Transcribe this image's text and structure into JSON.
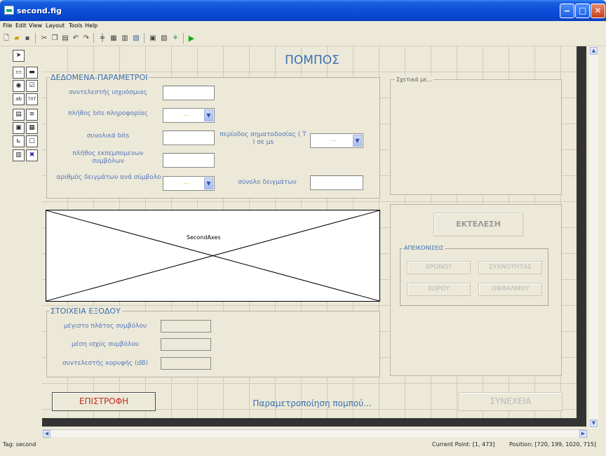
{
  "window": {
    "title": "second.fig"
  },
  "menu": [
    "File",
    "Edit",
    "View",
    "Layout",
    "Tools",
    "Help"
  ],
  "toolbar_icons": [
    "new-icon",
    "open-icon",
    "save-icon",
    "cut-icon",
    "copy-icon",
    "paste-icon",
    "undo-icon",
    "redo-icon",
    "align-icon",
    "menu-editor-icon",
    "tab-order-icon",
    "toolbar-editor-icon",
    "mfile-editor-icon",
    "property-inspector-icon",
    "object-browser-icon",
    "run-icon"
  ],
  "palette": [
    {
      "name": "select-tool-icon",
      "glyph": "➤"
    },
    {
      "name": "push-button-tool-icon",
      "glyph": "▭"
    },
    {
      "name": "slider-tool-icon",
      "glyph": "▬"
    },
    {
      "name": "radio-button-tool-icon",
      "glyph": "◉"
    },
    {
      "name": "checkbox-tool-icon",
      "glyph": "☑"
    },
    {
      "name": "edit-text-tool-icon",
      "glyph": "ab"
    },
    {
      "name": "static-text-tool-icon",
      "glyph": "TXT"
    },
    {
      "name": "popup-menu-tool-icon",
      "glyph": "▤"
    },
    {
      "name": "listbox-tool-icon",
      "glyph": "≡"
    },
    {
      "name": "toggle-button-tool-icon",
      "glyph": "▣"
    },
    {
      "name": "table-tool-icon",
      "glyph": "▦"
    },
    {
      "name": "axes-tool-icon",
      "glyph": "⊾"
    },
    {
      "name": "panel-tool-icon",
      "glyph": "▢"
    },
    {
      "name": "button-group-tool-icon",
      "glyph": "▥"
    },
    {
      "name": "activex-tool-icon",
      "glyph": "✖"
    }
  ],
  "form": {
    "main_title": "ΠΟΜΠΟΣ",
    "params_panel": {
      "title": "ΔΕΔΟΜΕΝΑ-ΠΑΡΑΜΕΤΡΟΙ",
      "label_coeff": "συντελεστής ισχυόσμιας",
      "label_bits_info": "πλήθος bits πληροφορίας",
      "label_total_bits": "συνολικά bits",
      "label_symbols": "πλήθος εκπεμπομενων συμβόλων",
      "label_samples_per_symbol": "αριθμός δειγμάτων ανά σύμβολο",
      "label_period": "περίοδος σηματοδοσίας ( T ) σε μs",
      "label_total_samples": "σύνολο δειγμάτων",
      "popup_value": "..."
    },
    "about_panel": {
      "title": "Σχετικά με..."
    },
    "axes": {
      "label": "SecondAxes"
    },
    "run_button": "ΕΚΤΕΛΕΣΗ",
    "display_group": {
      "title": "ΑΠΕΙΚΟΝΙΣΕΙΣ",
      "time_button": "ΧΡΟΝΟΥ",
      "freq_button": "ΣΥΧΝΟΤΗΤΑΣ",
      "space_button": "ΧΩΡΟΥ",
      "eye_button": "ΟΦΘΑΛΜΟΥ"
    },
    "output_panel": {
      "title": "ΣΤΟΙΧΕΙΑ ΕΞΟΔΟΥ",
      "max_amplitude": "μέγιστο πλάτος συμβόλου",
      "mean_power": "μέση ισχύς συμβόλου",
      "crest_factor": "συντελεστής κορυφής (dB)"
    },
    "back_button": "ΕΠΙΣΤΡΟΦΗ",
    "status_text": "Παραμετροποίηση πομπού...",
    "next_button": "ΣΥΝΕΧΕΙΑ"
  },
  "statusbar": {
    "tag": "Tag: second",
    "current_point": "Current Point:  [1, 473]",
    "position": "Position: [720, 199, 1020, 715]"
  }
}
